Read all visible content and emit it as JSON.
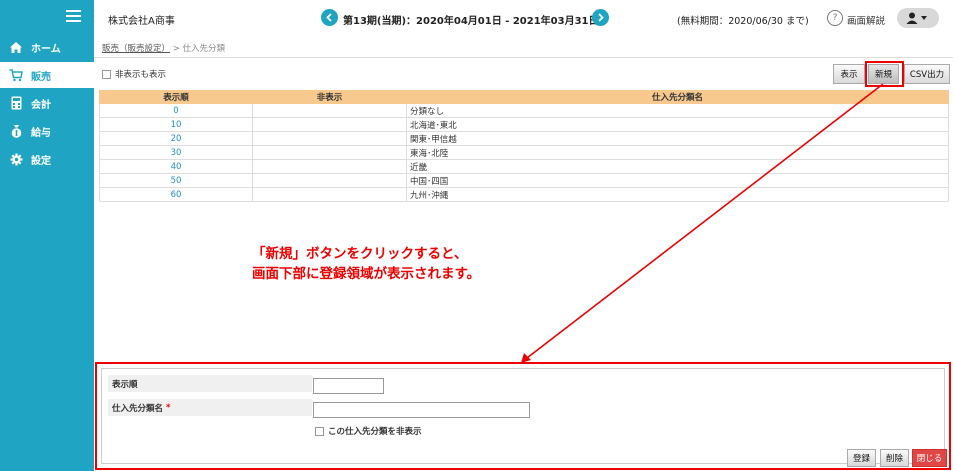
{
  "sidebar": {
    "items": [
      {
        "label": "ホーム",
        "icon": "home-icon"
      },
      {
        "label": "販売",
        "icon": "cart-icon"
      },
      {
        "label": "会計",
        "icon": "calculator-icon"
      },
      {
        "label": "給与",
        "icon": "money-bag-icon"
      },
      {
        "label": "設定",
        "icon": "gear-icon"
      }
    ],
    "active_index": 1
  },
  "header": {
    "company": "株式会社A商事",
    "period": "第13期(当期)：2020年04月01日 - 2021年03月31日",
    "free_period": "(無料期間：2020/06/30 まで)",
    "help_label": "画面解説",
    "help_icon_glyph": "?"
  },
  "breadcrumb": {
    "link": "販売（販売設定）",
    "separator": ">",
    "current": "仕入先分類"
  },
  "filter": {
    "show_hidden_label": "非表示も表示"
  },
  "toolbar": {
    "show_label": "表示",
    "new_label": "新規",
    "csv_label": "CSV出力"
  },
  "table": {
    "headers": [
      "表示順",
      "非表示",
      "仕入先分類名"
    ],
    "rows": [
      {
        "order": "0",
        "hidden": "",
        "name": "分類なし"
      },
      {
        "order": "10",
        "hidden": "",
        "name": "北海道･東北"
      },
      {
        "order": "20",
        "hidden": "",
        "name": "関東･甲信越"
      },
      {
        "order": "30",
        "hidden": "",
        "name": "東海･北陸"
      },
      {
        "order": "40",
        "hidden": "",
        "name": "近畿"
      },
      {
        "order": "50",
        "hidden": "",
        "name": "中国･四国"
      },
      {
        "order": "60",
        "hidden": "",
        "name": "九州･沖縄"
      }
    ]
  },
  "annotation": {
    "line1": "「新規」ボタンをクリックすると、",
    "line2": "画面下部に登録領域が表示されます。"
  },
  "form": {
    "order_label": "表示順",
    "name_label": "仕入先分類名",
    "required_mark": "*",
    "order_value": "",
    "name_value": "",
    "hide_label": "この仕入先分類を非表示",
    "register_label": "登録",
    "delete_label": "削除",
    "close_label": "閉じる"
  },
  "colors": {
    "accent": "#1fa5c3",
    "header_row": "#f7c98e",
    "highlight": "#e00000",
    "close_button": "#e04646"
  }
}
